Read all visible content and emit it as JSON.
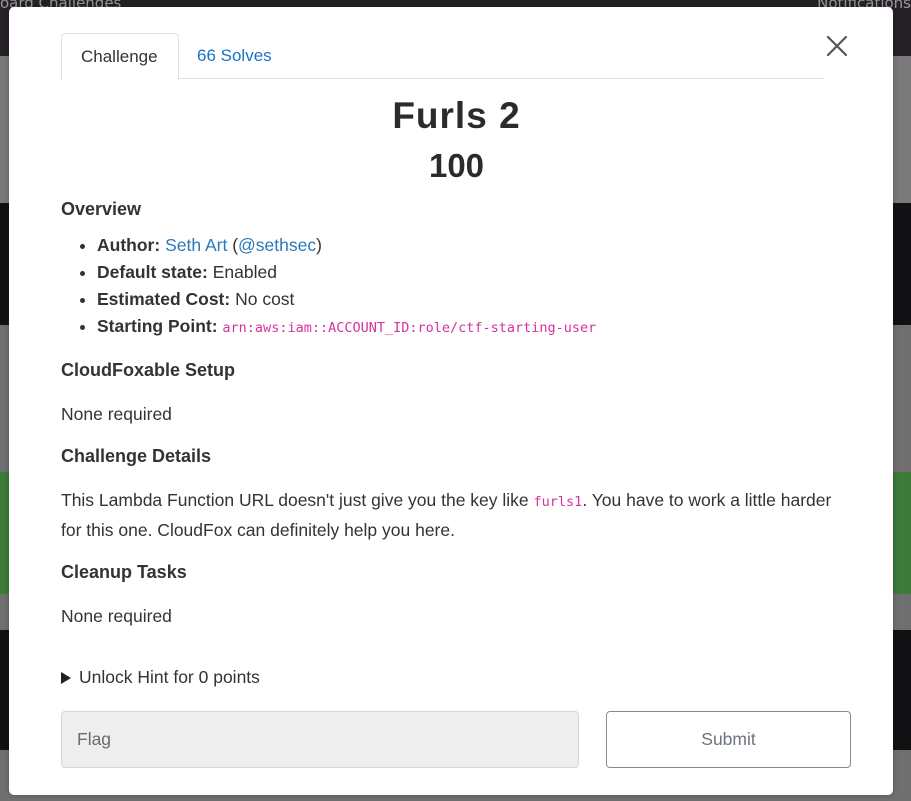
{
  "background": {
    "nav_left": "oard    Challenges",
    "nav_right": "Notifications"
  },
  "tabs": [
    {
      "label": "Challenge",
      "active": true
    },
    {
      "label": "66 Solves",
      "active": false
    }
  ],
  "challenge": {
    "title": "Furls 2",
    "points": "100"
  },
  "overview": {
    "heading": "Overview",
    "author_label": "Author:",
    "author_name": "Seth Art",
    "author_handle": "@sethsec",
    "default_state_label": "Default state:",
    "default_state_value": "Enabled",
    "cost_label": "Estimated Cost:",
    "cost_value": "No cost",
    "starting_point_label": "Starting Point:",
    "starting_point_value": "arn:aws:iam::ACCOUNT_ID:role/ctf-starting-user"
  },
  "setup": {
    "heading": "CloudFoxable Setup",
    "text": "None required"
  },
  "details": {
    "heading": "Challenge Details",
    "text_before": "This Lambda Function URL doesn't just give you the key like ",
    "code": "furls1",
    "text_after": ". You have to work a little harder for this one. CloudFox can definitely help you here."
  },
  "cleanup": {
    "heading": "Cleanup Tasks",
    "text": "None required"
  },
  "hint": {
    "label": "Unlock Hint for 0 points"
  },
  "form": {
    "flag_placeholder": "Flag",
    "submit_label": "Submit"
  },
  "colors": {
    "link": "#2a78b8",
    "tab_link": "#1a73c8",
    "code": "#d6339a"
  }
}
